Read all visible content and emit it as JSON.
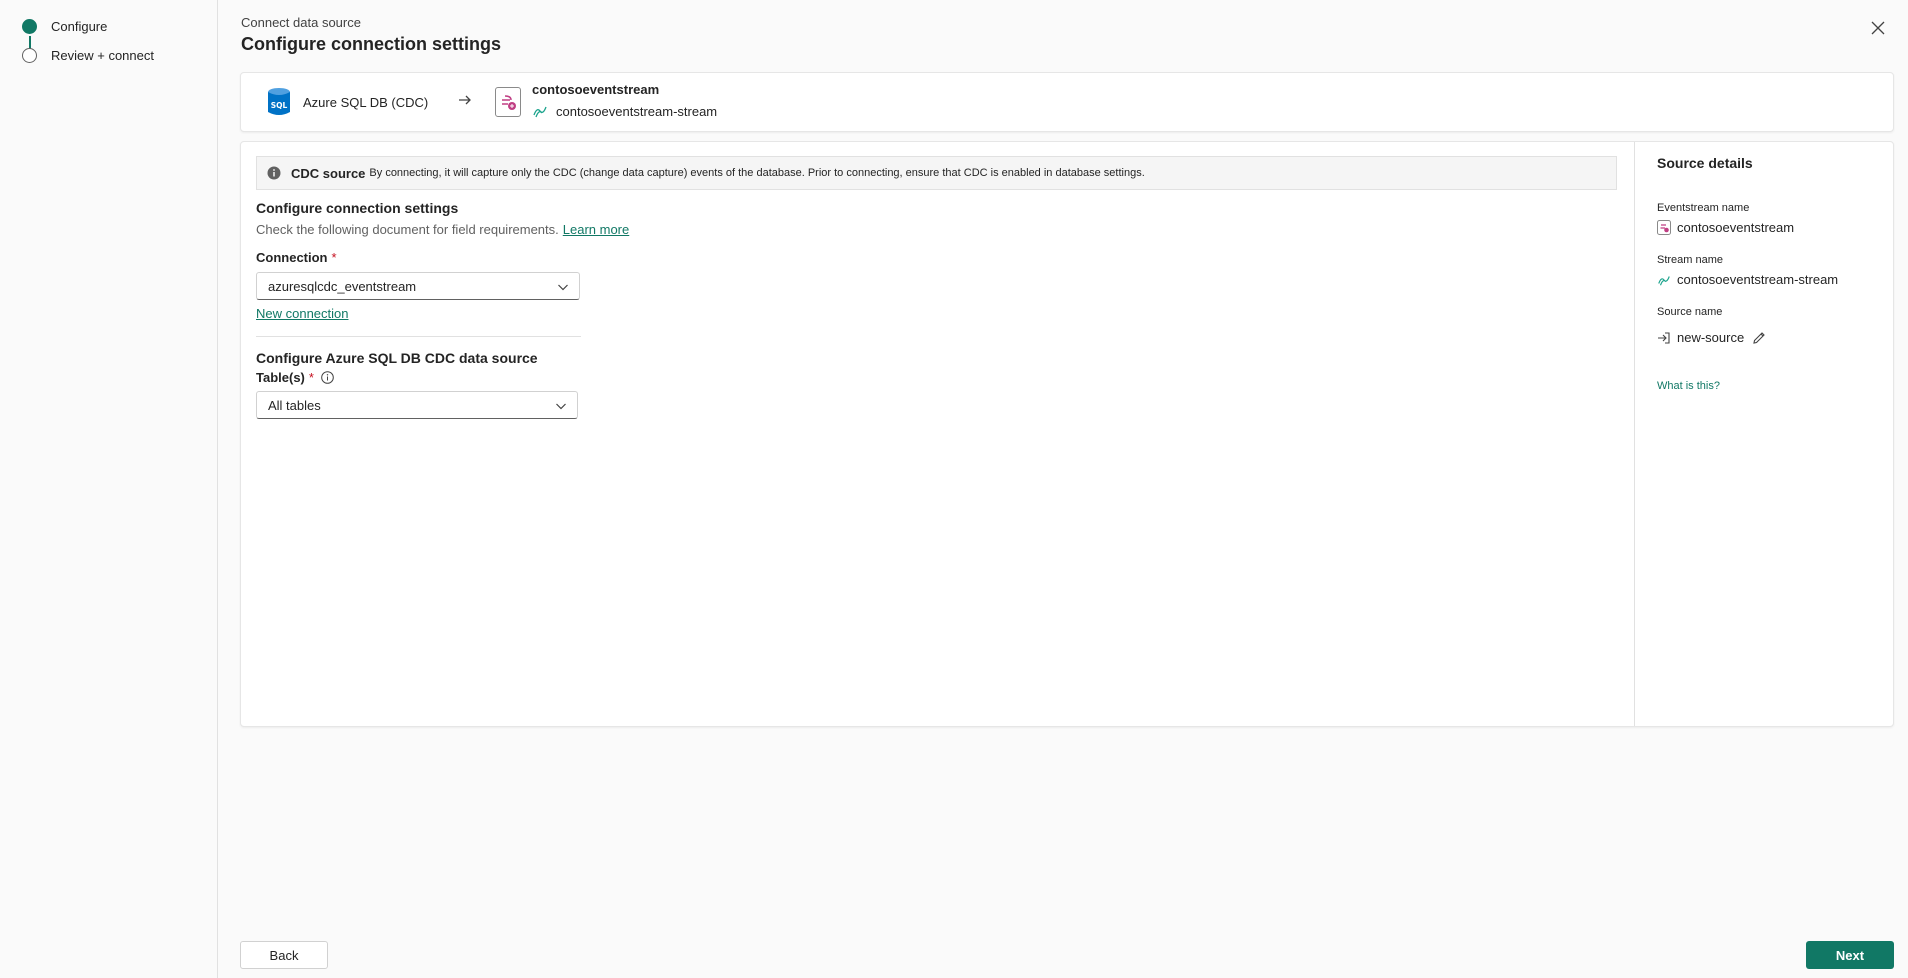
{
  "colors": {
    "accent": "#117865",
    "required": "#c50f1f",
    "sql_blue": "#0072c6",
    "eventstream_pink": "#c03f84"
  },
  "steps": [
    {
      "label": "Configure",
      "state": "active"
    },
    {
      "label": "Review + connect",
      "state": "pending"
    }
  ],
  "header": {
    "subtitle": "Connect data source",
    "title": "Configure connection settings",
    "close_icon": "close-icon"
  },
  "flow": {
    "source_icon": "sql-database-icon",
    "source_icon_text": "SQL",
    "source_name": "Azure SQL DB (CDC)",
    "arrow_icon": "arrow-right-icon",
    "eventstream_icon": "eventstream-icon",
    "eventstream_name": "contosoeventstream",
    "stream_icon": "stream-icon",
    "stream_name": "contosoeventstream-stream"
  },
  "info": {
    "icon": "info-icon",
    "title": "CDC source",
    "message": "By connecting, it will capture only the CDC (change data capture) events of the database. Prior to connecting, ensure that CDC is enabled in database settings."
  },
  "form": {
    "section1_title": "Configure connection settings",
    "help_text": "Check the following document for field requirements.",
    "learn_more": "Learn more",
    "connection_label": "Connection",
    "required_mark": "*",
    "connection_value": "azuresqlcdc_eventstream",
    "new_connection": "New connection",
    "section2_title": "Configure Azure SQL DB CDC data source",
    "tables_label": "Table(s)",
    "tables_value": "All tables"
  },
  "details": {
    "title": "Source details",
    "eventstream_label": "Eventstream name",
    "eventstream_value": "contosoeventstream",
    "stream_label": "Stream name",
    "stream_value": "contosoeventstream-stream",
    "source_label": "Source name",
    "source_value": "new-source",
    "what_is_this": "What is this?"
  },
  "footer": {
    "back": "Back",
    "next": "Next"
  }
}
